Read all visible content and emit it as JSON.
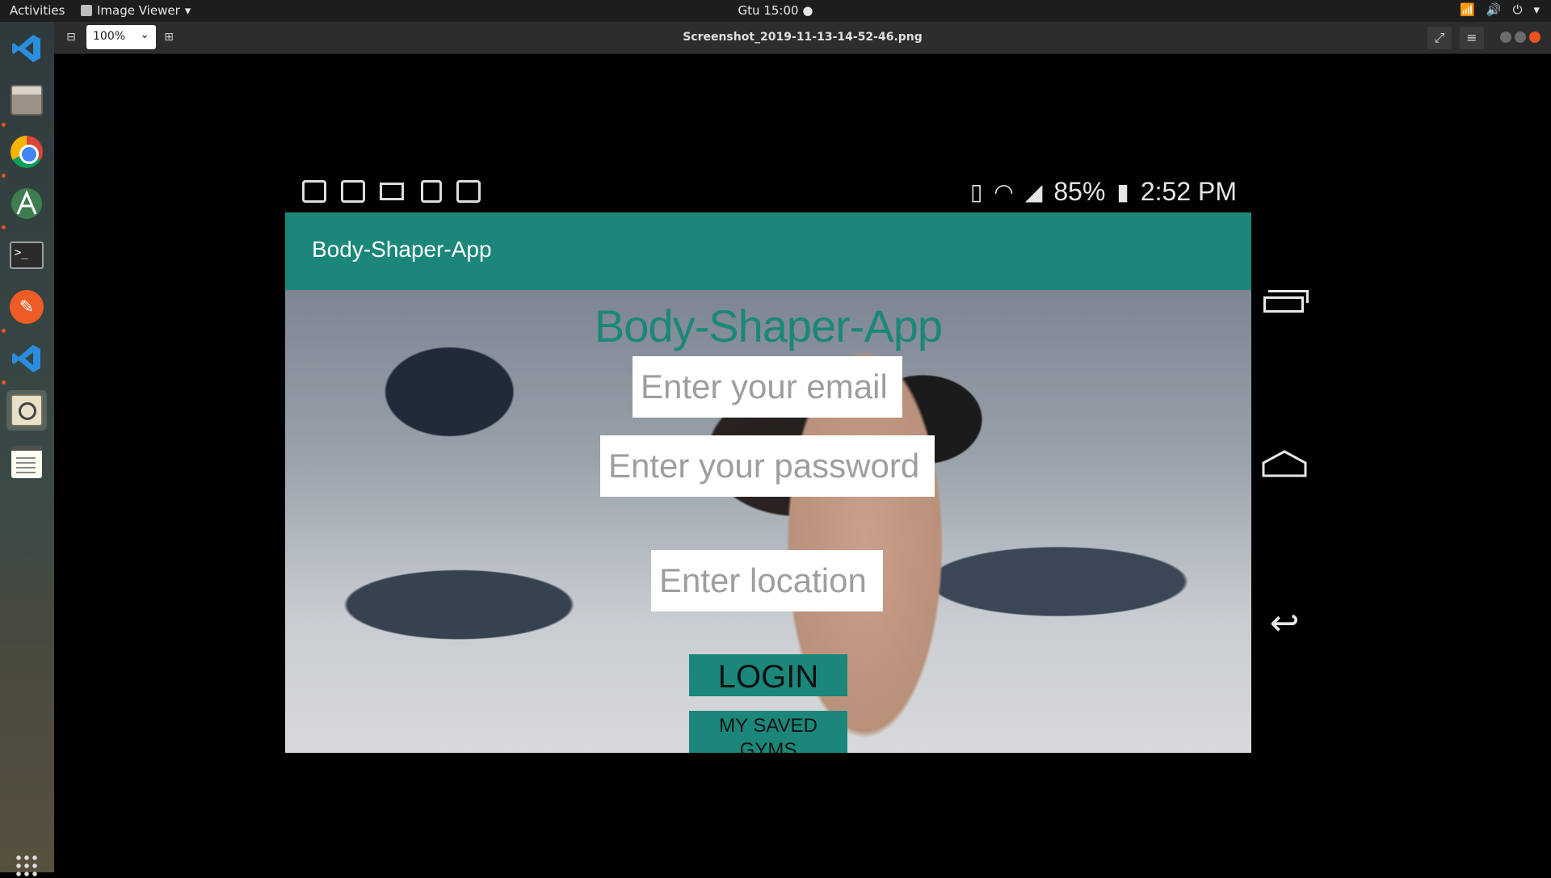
{
  "topbar": {
    "activities": "Activities",
    "app_menu": "Image Viewer",
    "clock": "Gtu 15:00"
  },
  "viewer": {
    "zoom": "100%",
    "filename": "Screenshot_2019-11-13-14-52-46.png"
  },
  "dock": {
    "items": [
      "vscode-icon",
      "files-icon",
      "chrome-icon",
      "android-studio-icon",
      "terminal-icon",
      "postman-icon",
      "vscode-icon",
      "image-viewer-icon",
      "text-editor-icon"
    ]
  },
  "phone": {
    "status": {
      "battery": "85%",
      "time": "2:52 PM"
    },
    "appbar_title": "Body-Shaper-App",
    "headline": "Body-Shaper-App",
    "email_placeholder": "Enter your email",
    "password_placeholder": "Enter your password",
    "location_placeholder": "Enter location",
    "login_label": "LOGIN",
    "saved_gyms_label": "MY SAVED GYMS"
  },
  "colors": {
    "accent": "#1a877a",
    "topbar": "#1d1d1d"
  }
}
